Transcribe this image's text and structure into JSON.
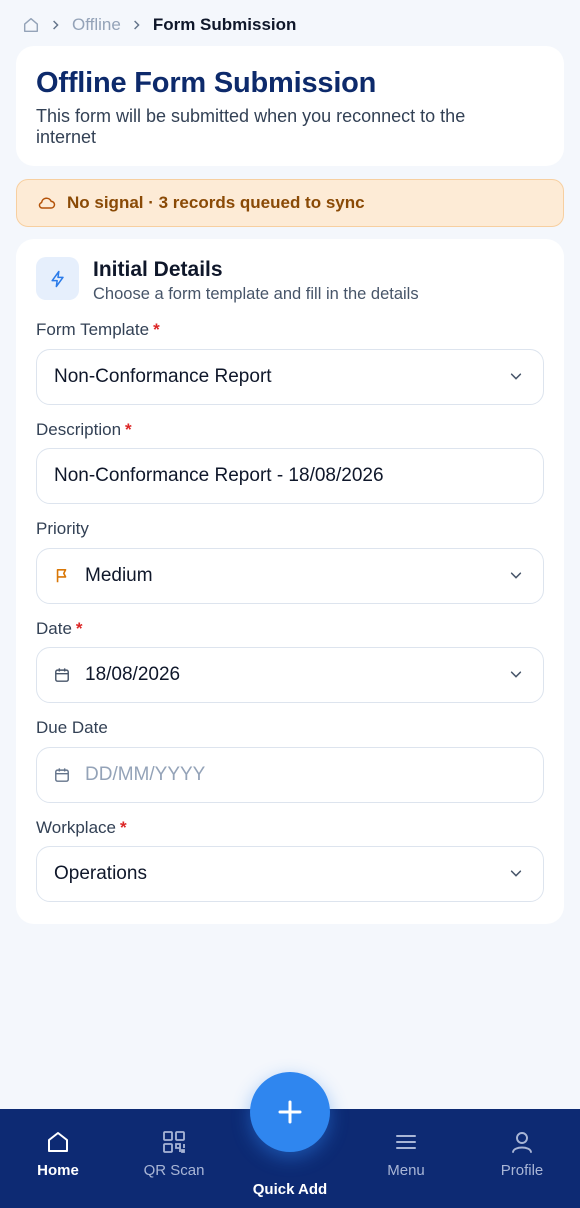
{
  "breadcrumb": {
    "items": [
      "Offline",
      "Form Submission"
    ]
  },
  "header": {
    "title": "Offline Form Submission",
    "subtitle": "This form will be submitted when you reconnect to the internet"
  },
  "banner": {
    "text": "No signal · 3 records queued to sync"
  },
  "section": {
    "title": "Initial Details",
    "subtitle": "Choose a form template and fill in the details"
  },
  "fields": {
    "form_template": {
      "label": "Form Template",
      "value": "Non-Conformance Report"
    },
    "description": {
      "label": "Description",
      "value": "Non-Conformance Report - 18/08/2026"
    },
    "priority": {
      "label": "Priority",
      "value": "Medium"
    },
    "date": {
      "label": "Date",
      "value": "18/08/2026"
    },
    "due_date": {
      "label": "Due Date",
      "placeholder": "DD/MM/YYYY"
    },
    "workplace": {
      "label": "Workplace",
      "value": "Operations"
    }
  },
  "required_marker": "*",
  "nav": {
    "home": "Home",
    "qr_scan": "QR Scan",
    "quick_add": "Quick Add",
    "menu": "Menu",
    "profile": "Profile"
  },
  "colors": {
    "brand_navy": "#0d2a73",
    "accent_blue": "#2f86ef",
    "warning_bg": "#fdebd6",
    "required_red": "#dc2626",
    "priority_medium": "#d97706"
  },
  "icons": [
    "home-icon",
    "chevron-right-icon",
    "cloud-off-icon",
    "lightning-icon",
    "chevron-down-icon",
    "flag-icon",
    "calendar-icon",
    "qr-code-icon",
    "plus-icon",
    "menu-icon",
    "user-icon"
  ]
}
